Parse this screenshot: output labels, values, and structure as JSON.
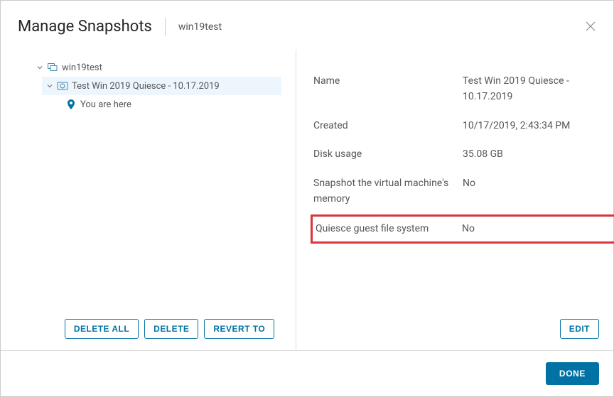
{
  "header": {
    "title": "Manage Snapshots",
    "subtitle": "win19test"
  },
  "tree": {
    "root_label": "win19test",
    "snapshot_label": "Test Win 2019 Quiesce - 10.17.2019",
    "here_label": "You are here"
  },
  "actions": {
    "delete_all": "DELETE ALL",
    "delete": "DELETE",
    "revert_to": "REVERT TO",
    "edit": "EDIT",
    "done": "DONE"
  },
  "details": {
    "name_label": "Name",
    "name_value": "Test Win 2019 Quiesce - 10.17.2019",
    "created_label": "Created",
    "created_value": "10/17/2019, 2:43:34 PM",
    "disk_label": "Disk usage",
    "disk_value": "35.08 GB",
    "memory_label": "Snapshot the virtual machine's memory",
    "memory_value": "No",
    "quiesce_label": "Quiesce guest file system",
    "quiesce_value": "No"
  }
}
